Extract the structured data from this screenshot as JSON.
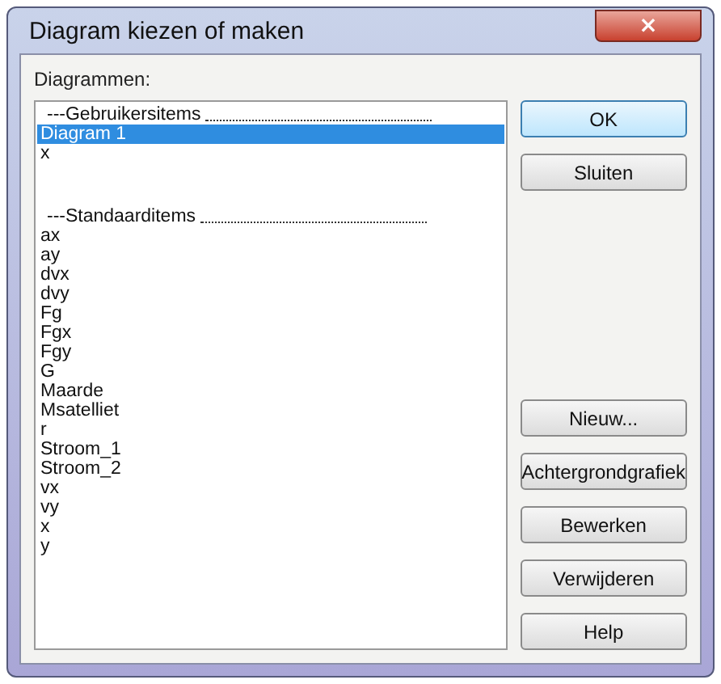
{
  "window": {
    "title": "Diagram kiezen of maken",
    "close": "×"
  },
  "list_label": "Diagrammen:",
  "list": [
    {
      "kind": "header",
      "label": "---Gebruikersitems",
      "selected": false
    },
    {
      "kind": "item",
      "label": "Diagram 1",
      "selected": true
    },
    {
      "kind": "item",
      "label": "x",
      "selected": false
    },
    {
      "kind": "header",
      "label": "---Standaarditems",
      "selected": false
    },
    {
      "kind": "item",
      "label": "ax",
      "selected": false
    },
    {
      "kind": "item",
      "label": "ay",
      "selected": false
    },
    {
      "kind": "item",
      "label": "dvx",
      "selected": false
    },
    {
      "kind": "item",
      "label": "dvy",
      "selected": false
    },
    {
      "kind": "item",
      "label": "Fg",
      "selected": false
    },
    {
      "kind": "item",
      "label": "Fgx",
      "selected": false
    },
    {
      "kind": "item",
      "label": "Fgy",
      "selected": false
    },
    {
      "kind": "item",
      "label": "G",
      "selected": false
    },
    {
      "kind": "item",
      "label": "Maarde",
      "selected": false
    },
    {
      "kind": "item",
      "label": "Msatelliet",
      "selected": false
    },
    {
      "kind": "item",
      "label": "r",
      "selected": false
    },
    {
      "kind": "item",
      "label": "Stroom_1",
      "selected": false
    },
    {
      "kind": "item",
      "label": "Stroom_2",
      "selected": false
    },
    {
      "kind": "item",
      "label": "vx",
      "selected": false
    },
    {
      "kind": "item",
      "label": "vy",
      "selected": false
    },
    {
      "kind": "item",
      "label": "x",
      "selected": false
    },
    {
      "kind": "item",
      "label": "y",
      "selected": false
    }
  ],
  "top_buttons": [
    {
      "label": "OK",
      "default": true
    },
    {
      "label": "Sluiten",
      "default": false
    }
  ],
  "bottom_buttons": [
    {
      "label": "Nieuw...",
      "default": false
    },
    {
      "label": "Achtergrondgrafiek",
      "default": false
    },
    {
      "label": "Bewerken",
      "default": false
    },
    {
      "label": "Verwijderen",
      "default": false
    },
    {
      "label": "Help",
      "default": false
    }
  ]
}
